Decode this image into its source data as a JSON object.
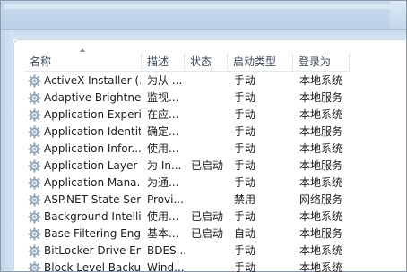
{
  "columns": {
    "name": "名称",
    "description": "描述",
    "status": "状态",
    "startup_type": "启动类型",
    "logon_as": "登录为"
  },
  "rows": [
    {
      "name": "ActiveX Installer (...",
      "description": "为从 ...",
      "status": "",
      "startup_type": "手动",
      "logon_as": "本地系统"
    },
    {
      "name": "Adaptive Brightness",
      "description": "监视...",
      "status": "",
      "startup_type": "手动",
      "logon_as": "本地服务"
    },
    {
      "name": "Application Experi...",
      "description": "在应...",
      "status": "",
      "startup_type": "手动",
      "logon_as": "本地系统"
    },
    {
      "name": "Application Identity",
      "description": "确定...",
      "status": "",
      "startup_type": "手动",
      "logon_as": "本地服务"
    },
    {
      "name": "Application Infor...",
      "description": "使用...",
      "status": "",
      "startup_type": "手动",
      "logon_as": "本地系统"
    },
    {
      "name": "Application Layer ...",
      "description": "为 In...",
      "status": "已启动",
      "startup_type": "手动",
      "logon_as": "本地服务"
    },
    {
      "name": "Application Mana...",
      "description": "为通...",
      "status": "",
      "startup_type": "手动",
      "logon_as": "本地系统"
    },
    {
      "name": "ASP.NET State Ser...",
      "description": "Provi...",
      "status": "",
      "startup_type": "禁用",
      "logon_as": "网络服务"
    },
    {
      "name": "Background Intelli...",
      "description": "使用...",
      "status": "已启动",
      "startup_type": "手动",
      "logon_as": "本地系统"
    },
    {
      "name": "Base Filtering Engi...",
      "description": "基本...",
      "status": "已启动",
      "startup_type": "自动",
      "logon_as": "本地服务"
    },
    {
      "name": "BitLocker Drive En...",
      "description": "BDES...",
      "status": "",
      "startup_type": "手动",
      "logon_as": "本地系统"
    },
    {
      "name": "Block Level Backu...",
      "description": "Wind...",
      "status": "",
      "startup_type": "手动",
      "logon_as": "本地系统"
    }
  ],
  "icons": {
    "row_icon": "gear-service-icon",
    "sort": "sort-ascending-icon"
  },
  "colors": {
    "text": "#1e1e1e",
    "header_text": "#3d4b5c",
    "frame": "#bcd1e8"
  }
}
